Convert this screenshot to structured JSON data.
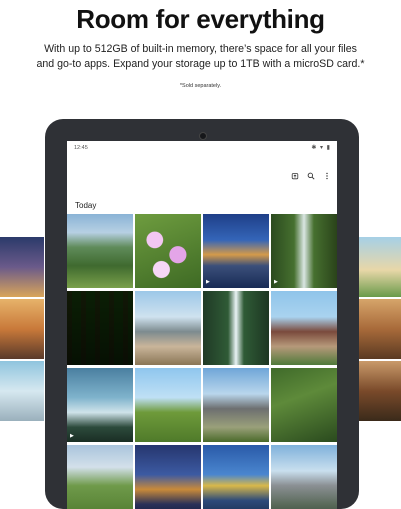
{
  "headline": "Room for everything",
  "description_line1": "With up to 512GB of built-in memory, there’s space for all your files",
  "description_line2": "and go-to apps. Expand your storage up to 1TB with a microSD card.*",
  "footnote": "*Sold separately.",
  "device": {
    "status_time": "12:45",
    "status_icons": "✱ ▾ ▮",
    "toolbar_icons": [
      "cloud-upload-icon",
      "search-icon",
      "more-vert-icon"
    ],
    "section_title": "Today",
    "photos": [
      {
        "name": "valley-photo",
        "video": false
      },
      {
        "name": "pink-flowers-photo",
        "video": false
      },
      {
        "name": "city-bridge-photo",
        "video": true
      },
      {
        "name": "waterfall-photo",
        "video": true
      },
      {
        "name": "forest-photo",
        "video": false
      },
      {
        "name": "boardwalk-photo",
        "video": false
      },
      {
        "name": "gorge-waterfall-photo",
        "video": false
      },
      {
        "name": "mansion-photo",
        "video": false
      },
      {
        "name": "lake-pier-photo",
        "video": true
      },
      {
        "name": "hikers-photo",
        "video": false
      },
      {
        "name": "house-photo",
        "video": false
      },
      {
        "name": "hiker-forest-photo",
        "video": false
      },
      {
        "name": "meadow-hikers-photo",
        "video": false
      },
      {
        "name": "night-skyline-photo",
        "video": false
      },
      {
        "name": "yellow-bridge-photo",
        "video": false
      },
      {
        "name": "downtown-photo",
        "video": false
      }
    ],
    "play_glyph": "▶"
  },
  "side_photos": {
    "left": [
      "concert-photo",
      "sunset-girl-photo",
      "kid-water-photo"
    ],
    "right": [
      "beach-palm-photo",
      "food-photo",
      "lights-photo"
    ]
  },
  "colors": {
    "tablet_body": "#2f3136",
    "screen": "#ffffff",
    "text": "#111111"
  }
}
